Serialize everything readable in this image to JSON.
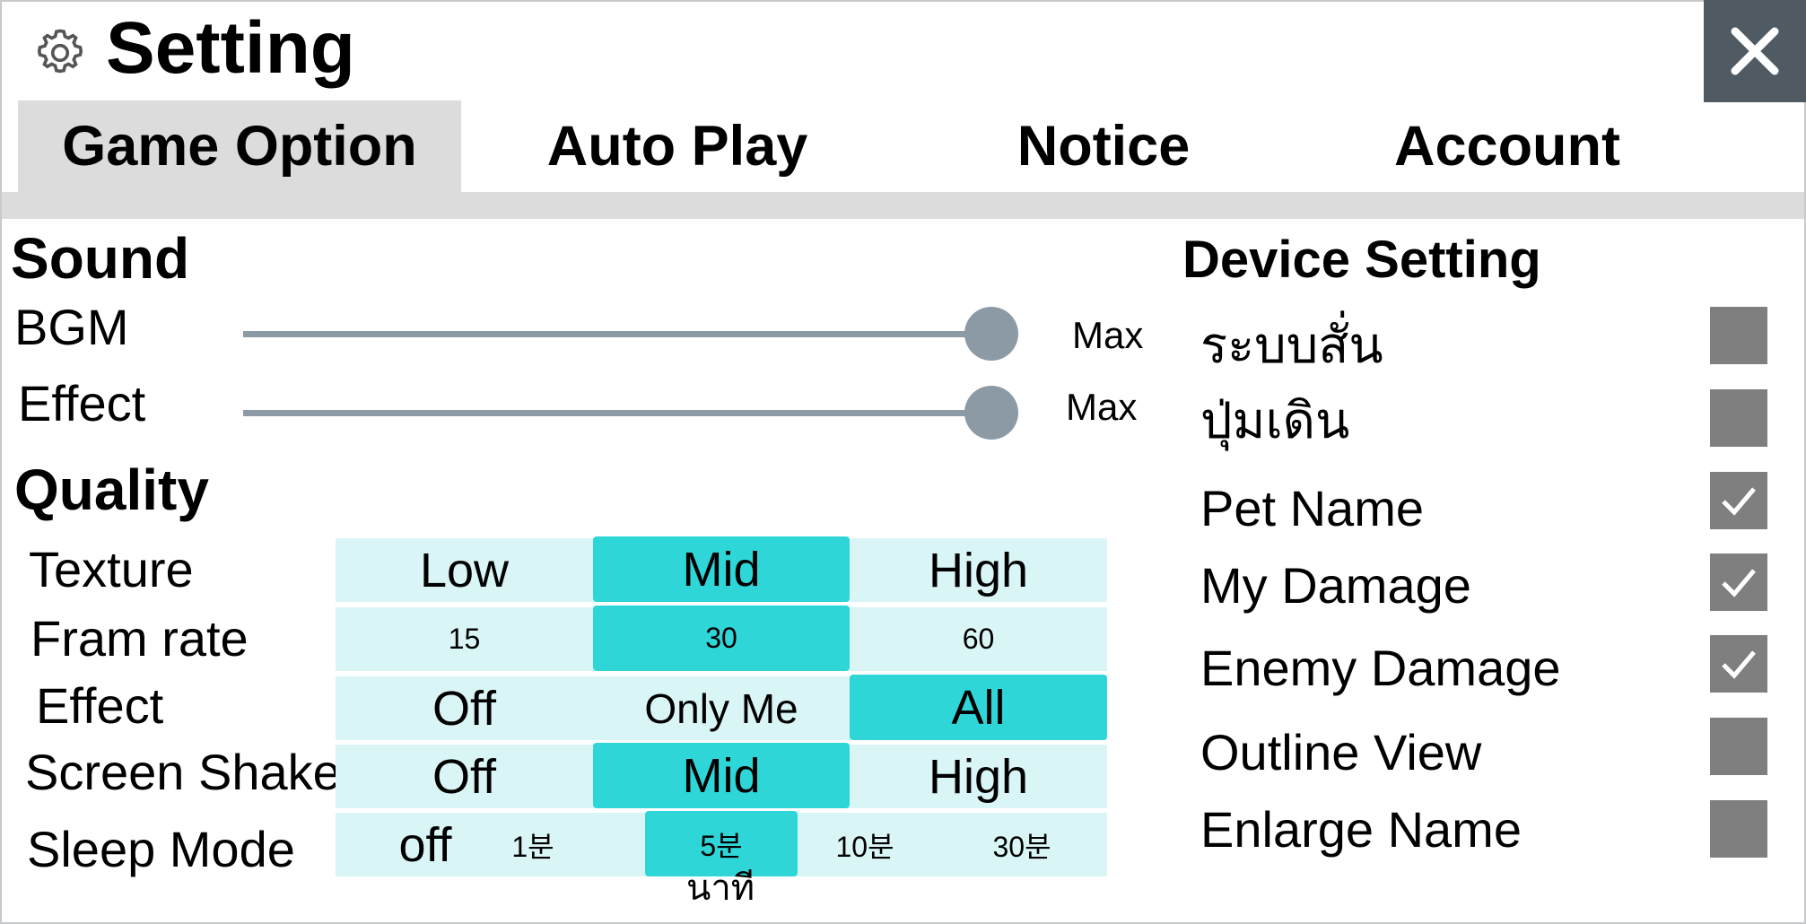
{
  "header": {
    "title": "Setting",
    "gear_icon": "gear-icon",
    "close_icon": "close-icon"
  },
  "tabs": [
    "Game Option",
    "Auto Play",
    "Notice",
    "Account"
  ],
  "sound": {
    "heading": "Sound",
    "bgm": {
      "label": "BGM",
      "value_label": "Max",
      "level": 1.0
    },
    "effect": {
      "label": "Effect",
      "value_label": "Max",
      "level": 1.0
    }
  },
  "quality": {
    "heading": "Quality",
    "texture": {
      "label": "Texture",
      "options": [
        "Low",
        "Mid",
        "High"
      ],
      "selected": "Mid"
    },
    "framerate": {
      "label": "Fram rate",
      "options": [
        "15",
        "30",
        "60"
      ],
      "selected": "30"
    },
    "effect": {
      "label": "Effect",
      "options": [
        "Off",
        "Only Me",
        "All"
      ],
      "selected": "All"
    },
    "screen_shake": {
      "label": "Screen Shake",
      "options": [
        "Off",
        "Mid",
        "High"
      ],
      "selected": "Mid"
    },
    "sleep_mode": {
      "label": "Sleep Mode",
      "options": [
        "off",
        "1분",
        "5분",
        "10분",
        "30분"
      ],
      "selected": "5분",
      "note": "นาที"
    }
  },
  "device": {
    "heading": "Device Setting",
    "items": [
      {
        "label": "ระบบสั่น",
        "checked": false
      },
      {
        "label": "ปุ่มเดิน",
        "checked": false
      },
      {
        "label": "Pet Name",
        "checked": true
      },
      {
        "label": "My Damage",
        "checked": true
      },
      {
        "label": "Enemy Damage",
        "checked": true
      },
      {
        "label": "Outline View",
        "checked": false
      },
      {
        "label": "Enlarge Name",
        "checked": false
      }
    ]
  },
  "colors": {
    "accent": "#2ed6d8",
    "option_bg": "#daf5f5",
    "slider": "#8c9aa6",
    "close_bg": "#4f5a63",
    "checkbox": "#7f7f7f"
  }
}
